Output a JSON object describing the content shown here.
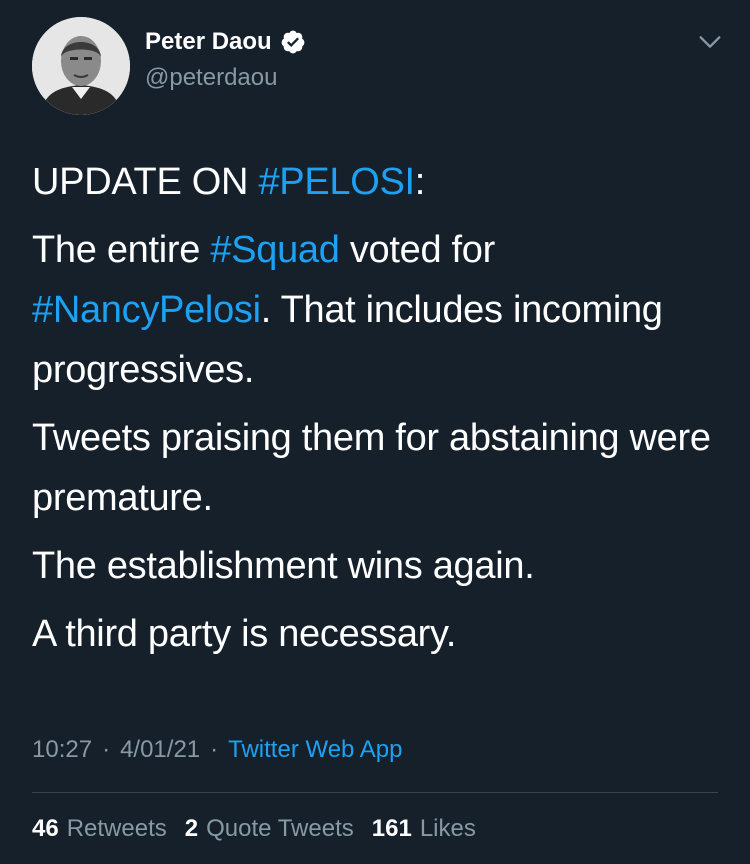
{
  "author": {
    "name": "Peter Daou",
    "handle": "@peterdaou",
    "verified": true
  },
  "tweet": {
    "line1": {
      "text": "UPDATE ON ",
      "hashtag": "#PELOSI",
      "after": ":"
    },
    "line2": {
      "pre": "The entire ",
      "hashtag1": "#Squad",
      "mid": " voted for ",
      "hashtag2": "#NancyPelosi",
      "post": ". That includes incoming progressives."
    },
    "line3": "Tweets praising them for abstaining were premature.",
    "line4": "The establishment wins again.",
    "line5": "A third party is necessary."
  },
  "meta": {
    "time": "10:27",
    "separator": "·",
    "date": "4/01/21",
    "source": "Twitter Web App"
  },
  "stats": {
    "retweets_count": "46",
    "retweets_label": "Retweets",
    "quotes_count": "2",
    "quotes_label": "Quote Tweets",
    "likes_count": "161",
    "likes_label": "Likes"
  },
  "colors": {
    "background": "#15202b",
    "accent": "#1da1f2",
    "secondary_text": "#8899a6"
  },
  "icons": {
    "verified": "verified-badge-icon",
    "more": "chevron-down-icon"
  }
}
